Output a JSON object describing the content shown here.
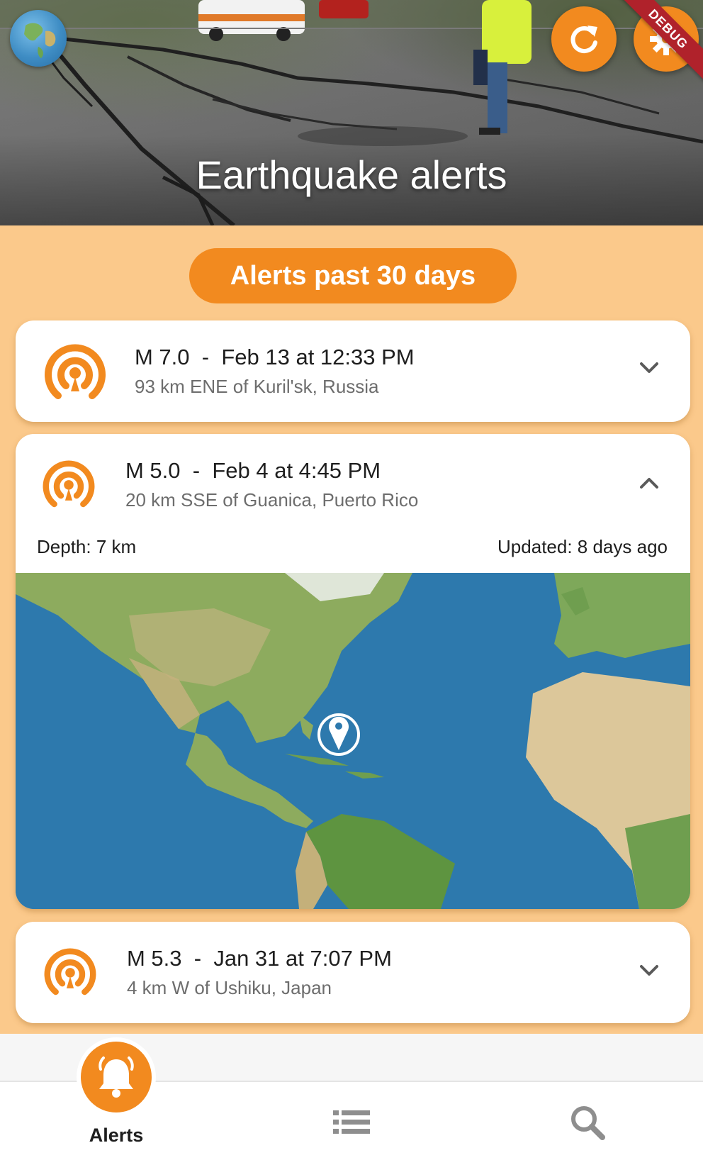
{
  "header": {
    "title": "Earthquake alerts",
    "debug_badge": "DEBUG"
  },
  "section": {
    "title": "Alerts past 30 days"
  },
  "alerts": [
    {
      "magnitude": "M 7.0",
      "separator": "-",
      "time": "Feb 13 at 12:33 PM",
      "location": "93 km ENE of Kuril'sk, Russia",
      "expanded": false
    },
    {
      "magnitude": "M 5.0",
      "separator": "-",
      "time": "Feb 4 at 4:45 PM",
      "location": "20 km SSE of Guanica, Puerto Rico",
      "expanded": true,
      "depth": "Depth: 7 km",
      "updated": "Updated: 8 days ago"
    },
    {
      "magnitude": "M 5.3",
      "separator": "-",
      "time": "Jan 31 at 7:07 PM",
      "location": "4 km W of Ushiku, Japan",
      "expanded": false
    }
  ],
  "bottom_nav": {
    "items": [
      {
        "label": "Alerts",
        "icon": "bell-icon",
        "active": true
      },
      {
        "label": "",
        "icon": "list-icon",
        "active": false
      },
      {
        "label": "",
        "icon": "search-icon",
        "active": false
      }
    ]
  },
  "colors": {
    "accent": "#f28a1f",
    "background": "#fbc98b",
    "card": "#ffffff",
    "debug_ribbon": "#b0222b"
  }
}
